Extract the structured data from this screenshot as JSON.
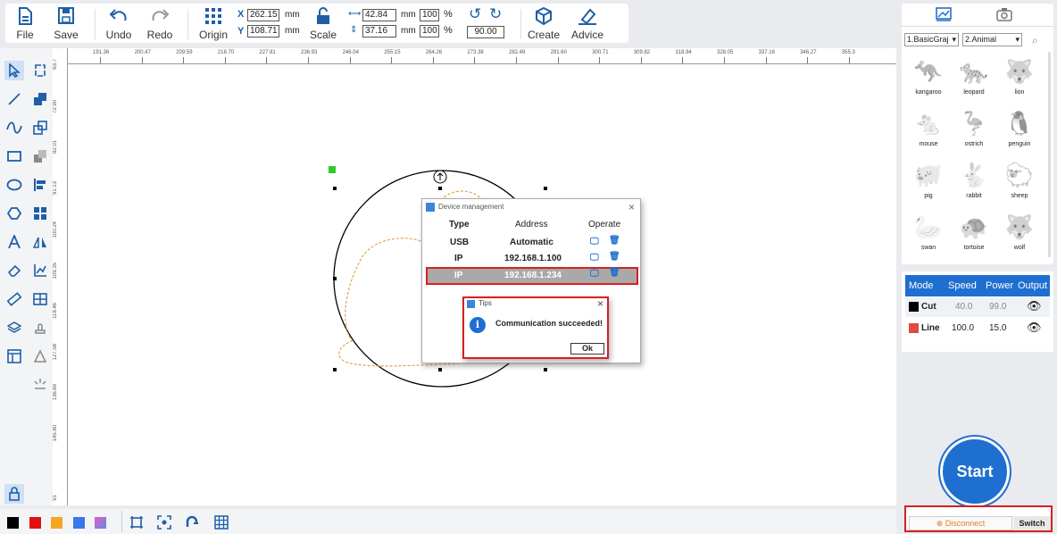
{
  "toolbar": {
    "file": "File",
    "save": "Save",
    "undo": "Undo",
    "redo": "Redo",
    "origin": "Origin",
    "x_label": "X",
    "x_value": "262.15",
    "y_label": "Y",
    "y_value": "108.71",
    "mm": "mm",
    "scale": "Scale",
    "width_value": "42.84",
    "height_value": "37.16",
    "width_pct": "100",
    "height_pct": "100",
    "pct": "%",
    "rotation": "90.00",
    "create": "Create",
    "advice": "Advice"
  },
  "ruler": {
    "h_ticks": [
      "191.36",
      "200.47",
      "209.59",
      "218.70",
      "227.81",
      "236.93",
      "246.04",
      "255.15",
      "264.26",
      "273.38",
      "282.49",
      "291.60",
      "300.71",
      "309.82",
      "318.94",
      "328.05",
      "337.16",
      "346.27",
      "355.3"
    ],
    "v_ticks": [
      "63.7",
      "72.90",
      "82.01",
      "91.13",
      "100.24",
      "109.35",
      "118.46",
      "127.58",
      "136.69",
      "145.80",
      "91"
    ],
    "unit": "mm"
  },
  "library": {
    "category1": "1.BasicGraj",
    "category2": "2.Animal",
    "animals": [
      "kangaroo",
      "leopard",
      "lion",
      "mouse",
      "ostrich",
      "penguin",
      "pig",
      "rabbit",
      "sheep",
      "swan",
      "tortoise",
      "wolf"
    ]
  },
  "layers": {
    "headers": [
      "Mode",
      "Speed",
      "Power",
      "Output"
    ],
    "rows": [
      {
        "mode": "Cut",
        "speed": "40.0",
        "power": "99.0",
        "color": "#000000"
      },
      {
        "mode": "Line",
        "speed": "100.0",
        "power": "15.0",
        "color": "#e04a3f"
      }
    ]
  },
  "start_label": "Start",
  "connection": {
    "disconnect": "Disconnect",
    "switch": "Switch"
  },
  "device_dialog": {
    "title": "Device management",
    "headers": [
      "Type",
      "Address",
      "Operate"
    ],
    "rows": [
      {
        "type": "USB",
        "address": "Automatic"
      },
      {
        "type": "IP",
        "address": "192.168.1.100"
      },
      {
        "type": "IP",
        "address": "192.168.1.234"
      }
    ]
  },
  "tips_dialog": {
    "title": "Tips",
    "message": "Communication succeeded!",
    "ok": "Ok"
  },
  "colors": {
    "accent": "#1f6fd1",
    "highlight_border": "#d62020",
    "selection_bg": "#a9a9a9",
    "path_orange": "#e3a24a"
  },
  "bottom_swatches": [
    "#000000",
    "#e01010",
    "#f5a623",
    "#3b78e7",
    "#d66ad6"
  ]
}
